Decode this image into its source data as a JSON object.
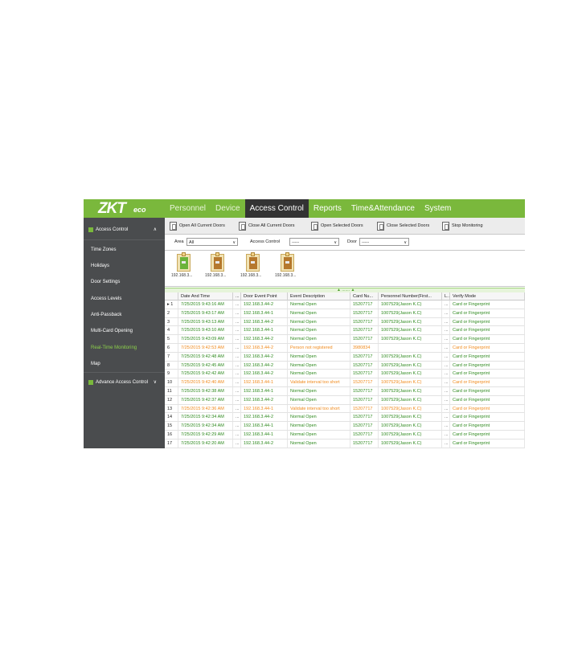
{
  "logo": {
    "main": "ZKT",
    "suffix": "eco"
  },
  "nav": [
    "Personnel",
    "Device",
    "Access Control",
    "Reports",
    "Time&Attendance",
    "System"
  ],
  "sidebar": {
    "section": "Access Control",
    "items": [
      "Time Zones",
      "Holidays",
      "Door Settings",
      "Access Levels",
      "Anti-Passback",
      "Multi-Card Opening",
      "Real-Time Monitoring",
      "Map"
    ],
    "section2": "Advance Access Control",
    "chevron_up": "∧",
    "chevron_down": "∨"
  },
  "toolbar": [
    "Open All Current Doors",
    "Close All Current Doors",
    "Open Selected Doors",
    "Close Selected Doors",
    "Stop Monitoring"
  ],
  "filters": {
    "area_label": "Area",
    "area_value": "All",
    "access_label": "Access Control",
    "access_value": "-----",
    "door_label": "Door",
    "door_value": "-----",
    "arrow": "∨"
  },
  "doors": [
    {
      "label": "192.168.3...",
      "state": "open"
    },
    {
      "label": "192.168.3...",
      "state": "closed"
    },
    {
      "label": "192.168.3...",
      "state": "closed"
    },
    {
      "label": "192.168.3...",
      "state": "closed"
    }
  ],
  "grid": {
    "grip": "▲ ....... ▲",
    "columns": [
      "",
      "Date And Time",
      "...",
      "Door Event Point",
      "Event Description",
      "Card Nu...",
      "Personnel Number(First...",
      "L...",
      "Verify Mode"
    ],
    "rows": [
      {
        "no": "▸ 1",
        "t": "7/25/2015 9:43:16 AM",
        "p": "192.168.3.44-2",
        "e": "Normal Open",
        "c": "15207717",
        "n": "1007529(Jason K.C)",
        "v": "Card or Fingerprint",
        "s": "ok"
      },
      {
        "no": "2",
        "t": "7/25/2015 9:43:17 AM",
        "p": "192.168.3.44-1",
        "e": "Normal Open",
        "c": "15207717",
        "n": "1007529(Jason K.C)",
        "v": "Card or Fingerprint",
        "s": "ok"
      },
      {
        "no": "3",
        "t": "7/25/2015 9:43:13 AM",
        "p": "192.168.3.44-2",
        "e": "Normal Open",
        "c": "15207717",
        "n": "1007529(Jason K.C)",
        "v": "Card or Fingerprint",
        "s": "ok"
      },
      {
        "no": "4",
        "t": "7/25/2015 9:43:10 AM",
        "p": "192.168.3.44-1",
        "e": "Normal Open",
        "c": "15207717",
        "n": "1007529(Jason K.C)",
        "v": "Card or Fingerprint",
        "s": "ok"
      },
      {
        "no": "5",
        "t": "7/25/2015 9:43:09 AM",
        "p": "192.168.3.44-2",
        "e": "Normal Open",
        "c": "15207717",
        "n": "1007529(Jason K.C)",
        "v": "Card or Fingerprint",
        "s": "ok"
      },
      {
        "no": "6",
        "t": "7/25/2015 9:42:53 AM",
        "p": "192.168.3.44-2",
        "e": "Person not registered",
        "c": "3980834",
        "n": "",
        "v": "Card or Fingerprint",
        "s": "warn"
      },
      {
        "no": "7",
        "t": "7/25/2015 9:42:48 AM",
        "p": "192.168.3.44-2",
        "e": "Normal Open",
        "c": "15207717",
        "n": "1007529(Jason K.C)",
        "v": "Card or Fingerprint",
        "s": "ok"
      },
      {
        "no": "8",
        "t": "7/25/2015 9:42:45 AM",
        "p": "192.168.3.44-2",
        "e": "Normal Open",
        "c": "15207717",
        "n": "1007529(Jason K.C)",
        "v": "Card or Fingerprint",
        "s": "ok"
      },
      {
        "no": "9",
        "t": "7/25/2015 9:42:42 AM",
        "p": "192.168.3.44-2",
        "e": "Normal Open",
        "c": "15207717",
        "n": "1007529(Jason K.C)",
        "v": "Card or Fingerprint",
        "s": "ok"
      },
      {
        "no": "10",
        "t": "7/25/2015 9:42:40 AM",
        "p": "192.168.3.44-1",
        "e": "Validate interval too short",
        "c": "15207717",
        "n": "1007529(Jason K.C)",
        "v": "Card or Fingerprint",
        "s": "warn"
      },
      {
        "no": "11",
        "t": "7/25/2015 9:42:38 AM",
        "p": "192.168.3.44-1",
        "e": "Normal Open",
        "c": "15207717",
        "n": "1007529(Jason K.C)",
        "v": "Card or Fingerprint",
        "s": "ok"
      },
      {
        "no": "12",
        "t": "7/25/2015 9:42:37 AM",
        "p": "192.168.3.44-2",
        "e": "Normal Open",
        "c": "15207717",
        "n": "1007529(Jason K.C)",
        "v": "Card or Fingerprint",
        "s": "ok"
      },
      {
        "no": "13",
        "t": "7/25/2015 9:42:36 AM",
        "p": "192.168.3.44-1",
        "e": "Validate interval too short",
        "c": "15207717",
        "n": "1007529(Jason K.C)",
        "v": "Card or Fingerprint",
        "s": "warn"
      },
      {
        "no": "14",
        "t": "7/25/2015 9:42:34 AM",
        "p": "192.168.3.44-2",
        "e": "Normal Open",
        "c": "15207717",
        "n": "1007529(Jason K.C)",
        "v": "Card or Fingerprint",
        "s": "ok"
      },
      {
        "no": "15",
        "t": "7/25/2015 9:42:34 AM",
        "p": "192.168.3.44-1",
        "e": "Normal Open",
        "c": "15207717",
        "n": "1007529(Jason K.C)",
        "v": "Card or Fingerprint",
        "s": "ok"
      },
      {
        "no": "16",
        "t": "7/25/2015 9:42:29 AM",
        "p": "192.168.3.44-1",
        "e": "Normal Open",
        "c": "15207717",
        "n": "1007529(Jason K.C)",
        "v": "Card or Fingerprint",
        "s": "ok"
      },
      {
        "no": "17",
        "t": "7/25/2015 9:42:20 AM",
        "p": "192.168.3.44-2",
        "e": "Normal Open",
        "c": "15207717",
        "n": "1007529(Jason K.C)",
        "v": "Card or Fingerprint",
        "s": "ok"
      }
    ]
  }
}
